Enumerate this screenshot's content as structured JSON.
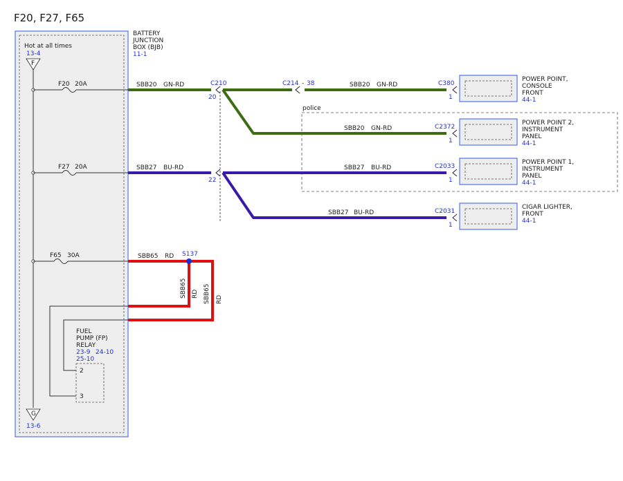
{
  "page_title": "F20, F27, F65",
  "bjb": {
    "label_lines": [
      "BATTERY",
      "JUNCTION",
      "BOX (BJB)"
    ],
    "ref": "11-1",
    "hot_label": "Hot at all times",
    "hot_ref": "13-4",
    "top_symbol": "F",
    "bottom_symbol": "G",
    "bottom_ref": "13-6"
  },
  "fuses": [
    {
      "id": "F20",
      "rating": "20A"
    },
    {
      "id": "F27",
      "rating": "20A"
    },
    {
      "id": "F65",
      "rating": "30A"
    }
  ],
  "relay": {
    "label_lines": [
      "FUEL",
      "PUMP (FP)",
      "RELAY"
    ],
    "refs": [
      "23-9",
      "24-10",
      "25-10"
    ],
    "pins": [
      "2",
      "3"
    ]
  },
  "connectors": {
    "c210": {
      "name": "C210",
      "pins": [
        "20",
        "22"
      ]
    },
    "c214": {
      "name": "C214",
      "dash": "-",
      "pin": "38"
    },
    "c380": {
      "name": "C380",
      "pin": "1"
    },
    "c2372": {
      "name": "C2372",
      "pin": "1"
    },
    "c2033": {
      "name": "C2033",
      "pin": "1"
    },
    "c2031": {
      "name": "C2031",
      "pin": "1"
    },
    "s137": {
      "name": "S137"
    }
  },
  "wires": {
    "sbb20_a": {
      "circuit": "SBB20",
      "color": "GN-RD"
    },
    "sbb20_b": {
      "circuit": "SBB20",
      "color": "GN-RD"
    },
    "sbb20_c": {
      "circuit": "SBB20",
      "color": "GN-RD"
    },
    "sbb27_a": {
      "circuit": "SBB27",
      "color": "BU-RD"
    },
    "sbb27_b": {
      "circuit": "SBB27",
      "color": "BU-RD"
    },
    "sbb27_c": {
      "circuit": "SBB27",
      "color": "BU-RD"
    },
    "sbb65_a": {
      "circuit": "SBB65",
      "color": "RD"
    },
    "sbb65_b": {
      "circuit": "SBB65",
      "color": "RD"
    },
    "sbb65_c": {
      "circuit": "SBB65",
      "color": "RD"
    }
  },
  "police_label": "police",
  "devices": [
    {
      "label_lines": [
        "POWER POINT,",
        "CONSOLE",
        "FRONT"
      ],
      "ref": "44-1"
    },
    {
      "label_lines": [
        "POWER POINT 2,",
        "INSTRUMENT",
        "PANEL"
      ],
      "ref": "44-1"
    },
    {
      "label_lines": [
        "POWER POINT 1,",
        "INSTRUMENT",
        "PANEL"
      ],
      "ref": "44-1"
    },
    {
      "label_lines": [
        "CIGAR LIGHTER,",
        "FRONT"
      ],
      "ref": "44-1"
    }
  ],
  "colors": {
    "green_wire": "#3f6b12",
    "blue_wire": "#3a1aa8",
    "red_wire": "#e01010",
    "reference_text": "#1f2fd6",
    "box_outline": "#3355ee",
    "box_fill": "#eeeeee",
    "splice_dot": "#1f2fd6"
  }
}
